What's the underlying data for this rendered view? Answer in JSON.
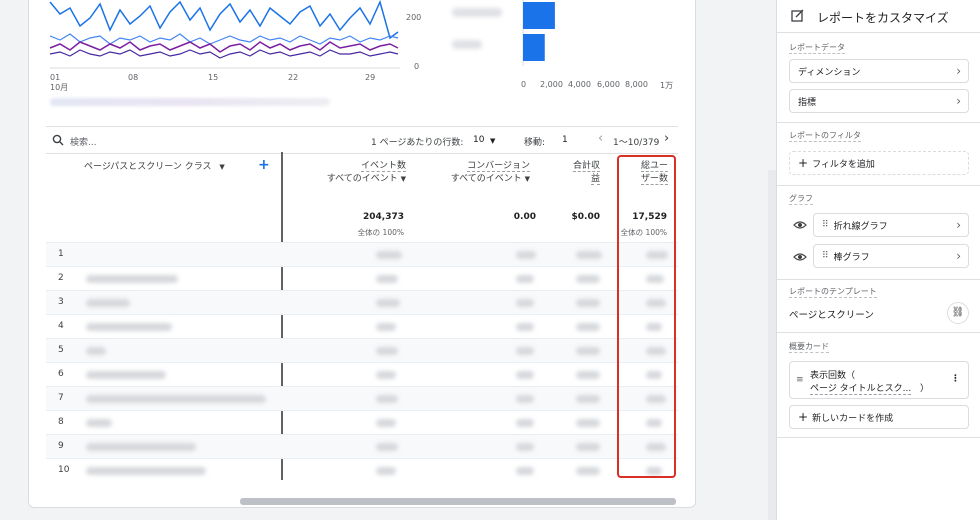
{
  "chart": {
    "x_ticks": [
      "01",
      "08",
      "15",
      "22",
      "29"
    ],
    "x_month": "10月",
    "y_ticks": [
      "200",
      "0"
    ],
    "series_colors": [
      "#1a73e8",
      "#7b1fa2",
      "#4527a0",
      "#4285f4"
    ]
  },
  "bar_chart": {
    "x_ticks": [
      "0",
      "2,000",
      "4,000",
      "6,000",
      "8,000",
      "1万"
    ],
    "bar_color": "#1a73e8",
    "values": [
      2200,
      1500
    ]
  },
  "toolbar": {
    "search_placeholder": "検索...",
    "rows_per_page_label": "1 ページあたりの行数:",
    "rows_per_page_value": "10",
    "goto_label": "移動:",
    "goto_value": "1",
    "pagination": "1～10/379"
  },
  "table": {
    "dim_header": "ページパスとスクリーン クラス",
    "columns": [
      {
        "line1": "イベント数",
        "line2": "すべてのイベント",
        "total": "204,373",
        "pct": "全体の 100%"
      },
      {
        "line1": "コンバージョン",
        "line2": "すべてのイベント",
        "total": "0.00",
        "pct": ""
      },
      {
        "line1": "合計収",
        "line2": "益",
        "total": "$0.00",
        "pct": ""
      },
      {
        "line1": "総ユー",
        "line2": "ザー数",
        "total": "17,529",
        "pct": "全体の 100%"
      }
    ],
    "rows": [
      "1",
      "2",
      "3",
      "4",
      "5",
      "6",
      "7",
      "8",
      "9",
      "10"
    ],
    "highlight_color": "#d93025"
  },
  "sidebar": {
    "title": "レポートをカスタマイズ",
    "report_data_label": "レポートデータ",
    "dimension": "ディメンション",
    "metric": "指標",
    "filter_label": "レポートのフィルタ",
    "add_filter": "フィルタを追加",
    "graph_label": "グラフ",
    "line_graph": "折れ線グラフ",
    "bar_graph": "棒グラフ",
    "template_label": "レポートのテンプレート",
    "template_value": "ページとスクリーン",
    "summary_label": "概要カード",
    "card_line1": "表示回数（",
    "card_line2": "ページ タイトルとスク...",
    "card_close": "）",
    "new_card": "新しいカードを作成"
  }
}
